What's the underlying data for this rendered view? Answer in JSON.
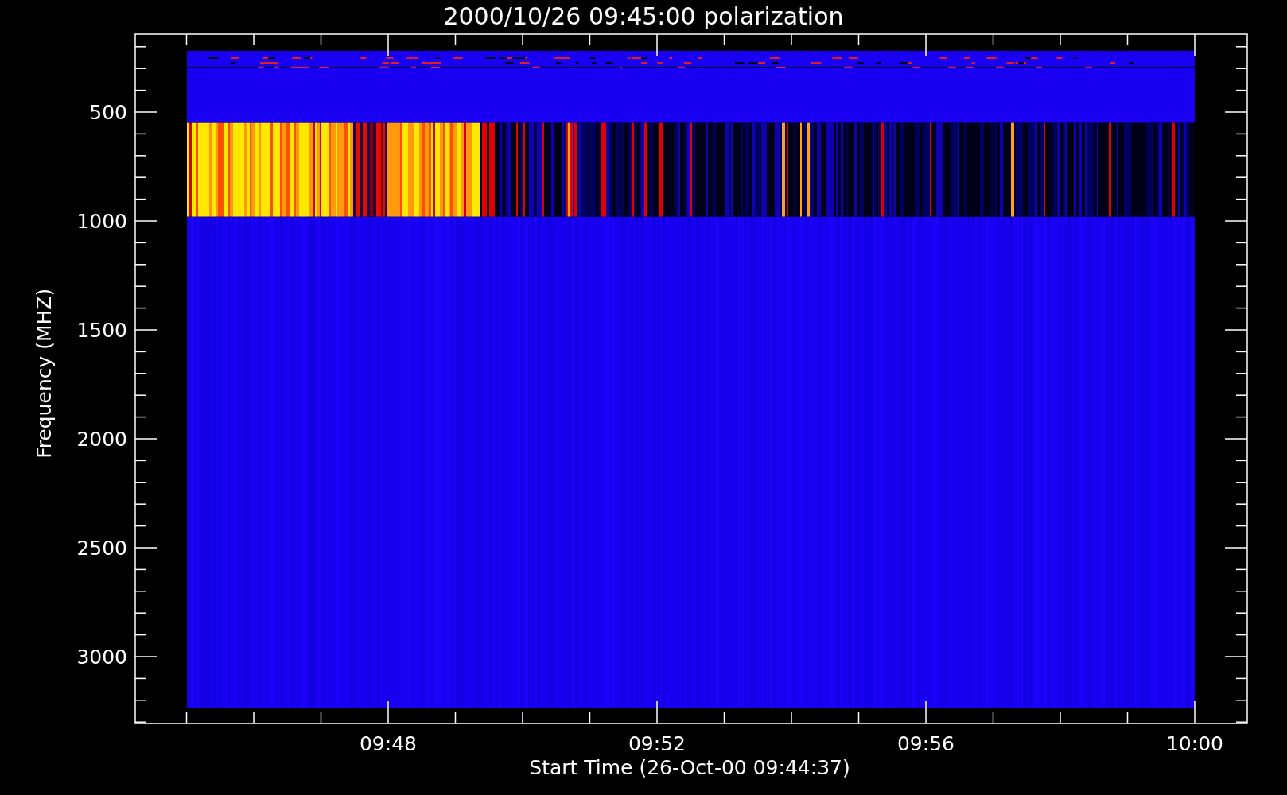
{
  "title": "2000/10/26 09:45:00 polarization",
  "y_axis": {
    "label": "Frequency (MHZ)",
    "ticks": [
      "500",
      "1000",
      "1500",
      "2000",
      "2500",
      "3000"
    ]
  },
  "x_axis": {
    "label": "Start Time (26-Oct-00 09:44:37)",
    "ticks": [
      "09:48",
      "09:52",
      "09:56",
      "10:00"
    ]
  }
}
